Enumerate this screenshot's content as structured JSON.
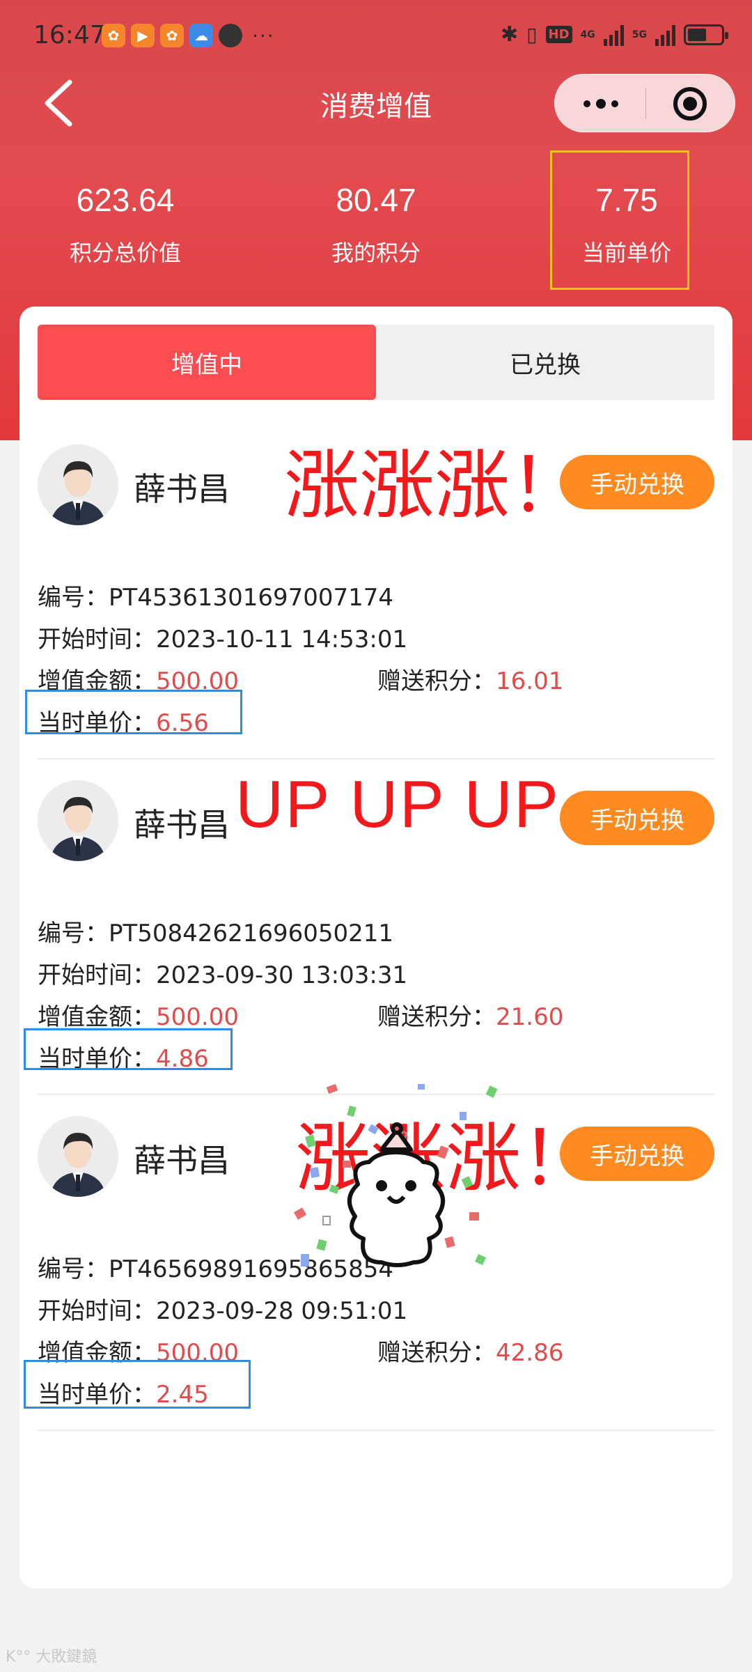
{
  "status_bar": {
    "time": "16:47",
    "more": "···",
    "hd": "HD",
    "net1": "4G",
    "net2": "5G"
  },
  "nav": {
    "title": "消费增值"
  },
  "stats": [
    {
      "value": "623.64",
      "label": "积分总价值"
    },
    {
      "value": "80.47",
      "label": "我的积分"
    },
    {
      "value": "7.75",
      "label": "当前单价"
    }
  ],
  "tabs": [
    {
      "label": "增值中",
      "active": true
    },
    {
      "label": "已兑换",
      "active": false
    }
  ],
  "records": [
    {
      "name": "薛书昌",
      "overlay": "涨涨涨！",
      "button": "手动兑换",
      "id_label": "编号：",
      "id": "PT45361301697007174",
      "start_label": "开始时间：",
      "start": "2023-10-11 14:53:01",
      "amount_label": "增值金额：",
      "amount": "500.00",
      "bonus_label": "赠送积分：",
      "bonus": "16.01",
      "price_label": "当时单价：",
      "price": "6.56"
    },
    {
      "name": "薛书昌",
      "overlay": "UP UP UP",
      "button": "手动兑换",
      "id_label": "编号：",
      "id": "PT50842621696050211",
      "start_label": "开始时间：",
      "start": "2023-09-30 13:03:31",
      "amount_label": "增值金额：",
      "amount": "500.00",
      "bonus_label": "赠送积分：",
      "bonus": "21.60",
      "price_label": "当时单价：",
      "price": "4.86"
    },
    {
      "name": "薛书昌",
      "overlay": "涨涨涨！",
      "button": "手动兑换",
      "id_label": "编号：",
      "id": "PT46569891695865854",
      "start_label": "开始时间：",
      "start": "2023-09-28 09:51:01",
      "amount_label": "增值金额：",
      "amount": "500.00",
      "bonus_label": "赠送积分：",
      "bonus": "42.86",
      "price_label": "当时单价：",
      "price": "2.45"
    }
  ],
  "watermark": "K°° 大敗鍵鏡",
  "colors": {
    "header_red": "#e24b4f",
    "tab_active": "#fb4d51",
    "button_orange": "#ff8a1f",
    "value_red": "#e04b4b",
    "overlay_red": "#f2191c",
    "highlight_yellow": "#f1c21b",
    "highlight_blue": "#2a8ee6"
  },
  "icons": {
    "back": "chevron-left-icon",
    "more": "more-dots-icon",
    "close": "target-close-icon",
    "avatar": "avatar-man-suit-icon"
  }
}
